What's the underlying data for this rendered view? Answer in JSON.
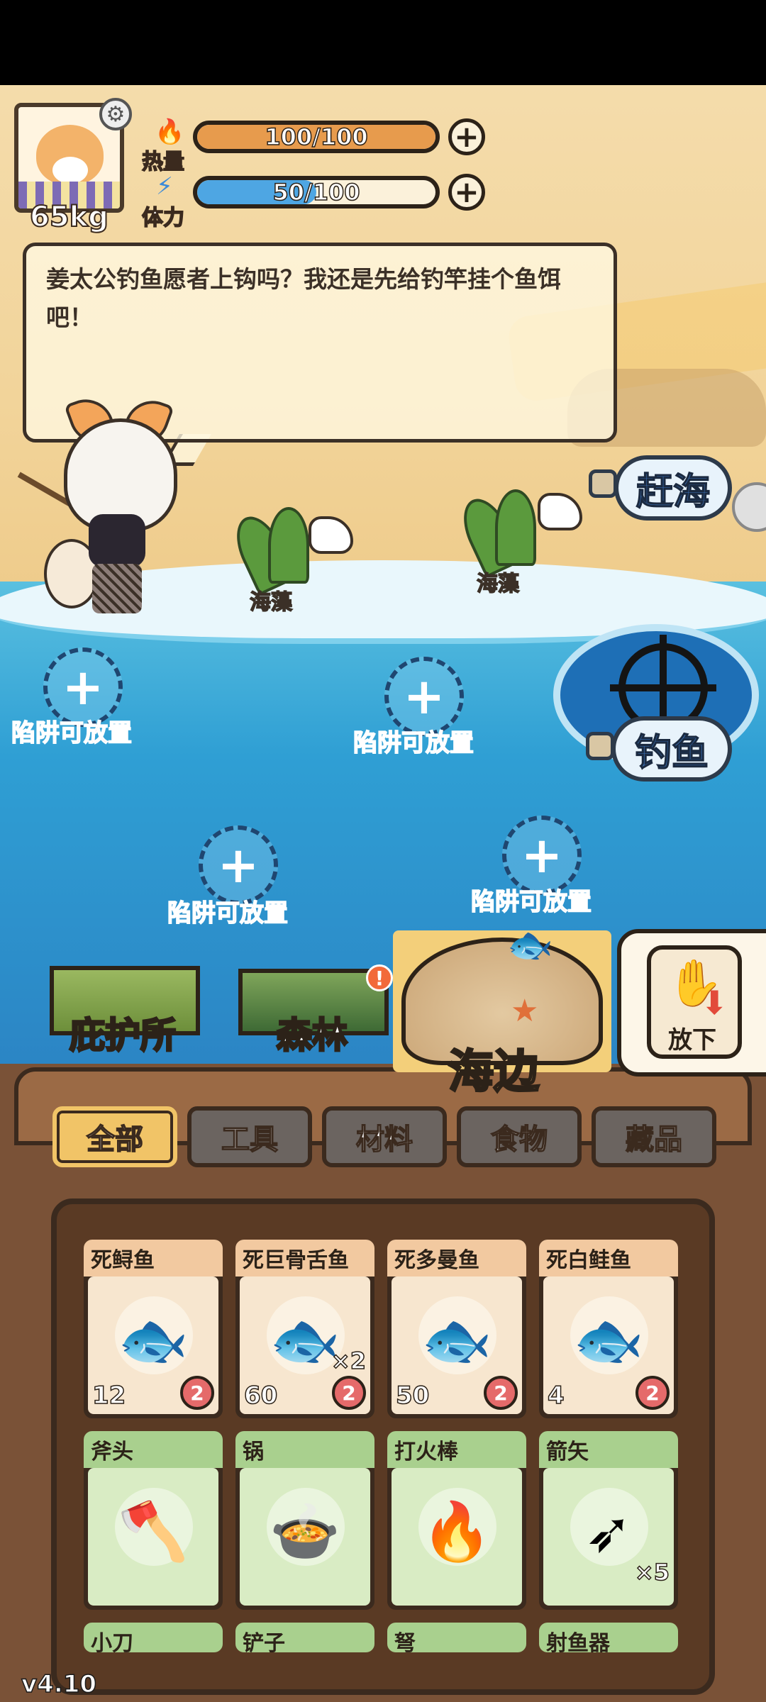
{
  "hud": {
    "weight": "65kg",
    "heat": {
      "label": "热量",
      "value": "100/100",
      "fill": 1.0,
      "color": "#e79b4d"
    },
    "stamina": {
      "label": "体力",
      "value": "50/100",
      "fill": 0.5,
      "color": "#4ea6e3"
    }
  },
  "dialog": {
    "text": "姜太公钓鱼愿者上钩吗？我还是先给钓竿挂个鱼饵吧！"
  },
  "scene": {
    "seaweed_label": "海藻",
    "gather_button": "赶海",
    "fishing_button": "钓鱼",
    "trap_label": "陷阱可放置",
    "trap_plus": "+"
  },
  "locations": [
    {
      "label": "庇护所"
    },
    {
      "label": "森林",
      "badge": "!"
    },
    {
      "label": "海边"
    }
  ],
  "drop": {
    "label": "放下"
  },
  "categories": [
    {
      "label": "全部"
    },
    {
      "label": "工具"
    },
    {
      "label": "材料"
    },
    {
      "label": "食物"
    },
    {
      "label": "藏品"
    }
  ],
  "inventory_row1": [
    {
      "name": "死鲟鱼",
      "count": "12",
      "time": "2",
      "icon": "dead-sturgeon"
    },
    {
      "name": "死巨骨舌鱼",
      "count": "60",
      "time": "2",
      "mult": "×2",
      "icon": "dead-arapaima"
    },
    {
      "name": "死多曼鱼",
      "count": "50",
      "time": "2",
      "icon": "dead-dorado"
    },
    {
      "name": "死白鲑鱼",
      "count": "4",
      "time": "2",
      "icon": "dead-whitefish"
    }
  ],
  "inventory_row2": [
    {
      "name": "斧头",
      "icon": "axe"
    },
    {
      "name": "锅",
      "icon": "pot"
    },
    {
      "name": "打火棒",
      "icon": "fire-starter"
    },
    {
      "name": "箭矢",
      "mult": "×5",
      "icon": "arrow"
    }
  ],
  "inventory_row3": [
    {
      "name": "小刀"
    },
    {
      "name": "铲子"
    },
    {
      "name": "弩"
    },
    {
      "name": "射鱼器"
    }
  ],
  "version": "v4.10",
  "colors": {
    "fish_header": "#f2c9a0",
    "fish_body": "#f7e6cf",
    "tool_header": "#a9d08e",
    "tool_body": "#d9ecc4",
    "active_tab": "#f1c467"
  }
}
